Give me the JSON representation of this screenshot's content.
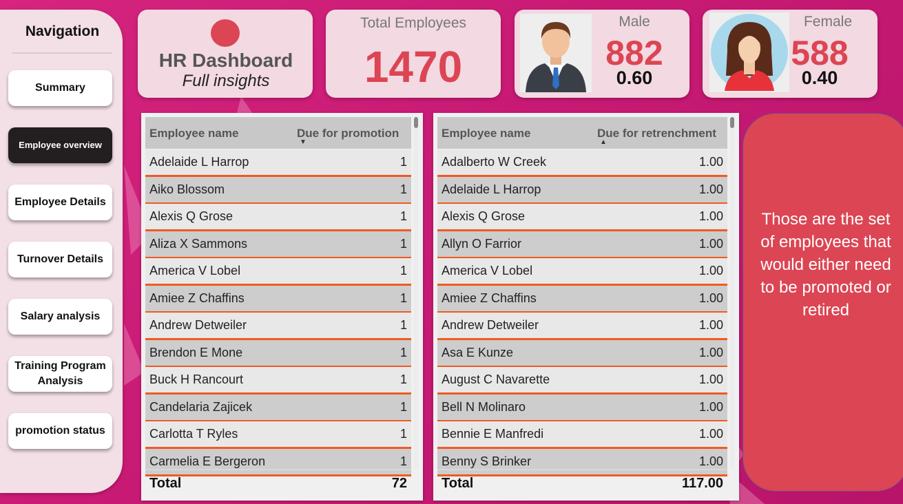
{
  "navigation": {
    "title": "Navigation",
    "items": [
      {
        "label": "Summary",
        "active": false
      },
      {
        "label": "Employee overview",
        "active": true
      },
      {
        "label": "Employee Details",
        "active": false
      },
      {
        "label": "Turnover Details",
        "active": false
      },
      {
        "label": "Salary analysis",
        "active": false
      },
      {
        "label": "Training Program Analysis",
        "active": false
      },
      {
        "label": "promotion status",
        "active": false
      }
    ]
  },
  "header": {
    "title": "HR Dashboard",
    "subtitle": "Full insights"
  },
  "kpis": {
    "total": {
      "label": "Total Employees",
      "value": "1470"
    },
    "male": {
      "label": "Male",
      "value": "882",
      "ratio": "0.60"
    },
    "female": {
      "label": "Female",
      "value": "588",
      "ratio": "0.40"
    }
  },
  "promotion_table": {
    "col_name": "Employee name",
    "col_value": "Due for promotion",
    "rows": [
      {
        "name": "Adelaide L Harrop",
        "value": "1"
      },
      {
        "name": "Aiko Blossom",
        "value": "1"
      },
      {
        "name": "Alexis Q Grose",
        "value": "1"
      },
      {
        "name": "Aliza X Sammons",
        "value": "1"
      },
      {
        "name": "America V Lobel",
        "value": "1"
      },
      {
        "name": "Amiee Z Chaffins",
        "value": "1"
      },
      {
        "name": "Andrew Detweiler",
        "value": "1"
      },
      {
        "name": "Brendon E Mone",
        "value": "1"
      },
      {
        "name": "Buck H Rancourt",
        "value": "1"
      },
      {
        "name": "Candelaria Zajicek",
        "value": "1"
      },
      {
        "name": "Carlotta T Ryles",
        "value": "1"
      },
      {
        "name": "Carmelia E Bergeron",
        "value": "1"
      }
    ],
    "total_label": "Total",
    "total_value": "72"
  },
  "retrenchment_table": {
    "col_name": "Employee name",
    "col_value": "Due for retrenchment",
    "rows": [
      {
        "name": "Adalberto W Creek",
        "value": "1.00"
      },
      {
        "name": "Adelaide L Harrop",
        "value": "1.00"
      },
      {
        "name": "Alexis Q Grose",
        "value": "1.00"
      },
      {
        "name": "Allyn O Farrior",
        "value": "1.00"
      },
      {
        "name": "America V Lobel",
        "value": "1.00"
      },
      {
        "name": "Amiee Z Chaffins",
        "value": "1.00"
      },
      {
        "name": "Andrew Detweiler",
        "value": "1.00"
      },
      {
        "name": "Asa E Kunze",
        "value": "1.00"
      },
      {
        "name": "August C Navarette",
        "value": "1.00"
      },
      {
        "name": "Bell N Molinaro",
        "value": "1.00"
      },
      {
        "name": "Bennie E Manfredi",
        "value": "1.00"
      },
      {
        "name": "Benny S Brinker",
        "value": "1.00"
      }
    ],
    "total_label": "Total",
    "total_value": "117.00"
  },
  "note": {
    "text": "Those are the set of employees that would either need to be promoted or retired"
  },
  "colors": {
    "accent": "#dc4553",
    "background": "#c81a74",
    "row_divider": "#f05a22"
  }
}
